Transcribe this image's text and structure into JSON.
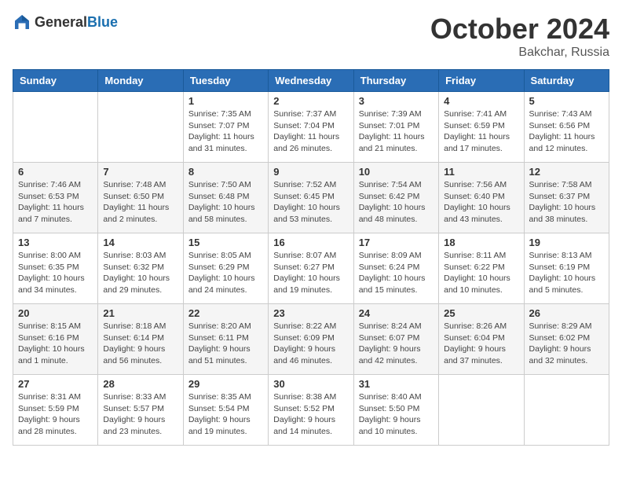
{
  "header": {
    "logo_general": "General",
    "logo_blue": "Blue",
    "month": "October 2024",
    "location": "Bakchar, Russia"
  },
  "weekdays": [
    "Sunday",
    "Monday",
    "Tuesday",
    "Wednesday",
    "Thursday",
    "Friday",
    "Saturday"
  ],
  "weeks": [
    [
      {
        "day": "",
        "info": ""
      },
      {
        "day": "",
        "info": ""
      },
      {
        "day": "1",
        "info": "Sunrise: 7:35 AM\nSunset: 7:07 PM\nDaylight: 11 hours and 31 minutes."
      },
      {
        "day": "2",
        "info": "Sunrise: 7:37 AM\nSunset: 7:04 PM\nDaylight: 11 hours and 26 minutes."
      },
      {
        "day": "3",
        "info": "Sunrise: 7:39 AM\nSunset: 7:01 PM\nDaylight: 11 hours and 21 minutes."
      },
      {
        "day": "4",
        "info": "Sunrise: 7:41 AM\nSunset: 6:59 PM\nDaylight: 11 hours and 17 minutes."
      },
      {
        "day": "5",
        "info": "Sunrise: 7:43 AM\nSunset: 6:56 PM\nDaylight: 11 hours and 12 minutes."
      }
    ],
    [
      {
        "day": "6",
        "info": "Sunrise: 7:46 AM\nSunset: 6:53 PM\nDaylight: 11 hours and 7 minutes."
      },
      {
        "day": "7",
        "info": "Sunrise: 7:48 AM\nSunset: 6:50 PM\nDaylight: 11 hours and 2 minutes."
      },
      {
        "day": "8",
        "info": "Sunrise: 7:50 AM\nSunset: 6:48 PM\nDaylight: 10 hours and 58 minutes."
      },
      {
        "day": "9",
        "info": "Sunrise: 7:52 AM\nSunset: 6:45 PM\nDaylight: 10 hours and 53 minutes."
      },
      {
        "day": "10",
        "info": "Sunrise: 7:54 AM\nSunset: 6:42 PM\nDaylight: 10 hours and 48 minutes."
      },
      {
        "day": "11",
        "info": "Sunrise: 7:56 AM\nSunset: 6:40 PM\nDaylight: 10 hours and 43 minutes."
      },
      {
        "day": "12",
        "info": "Sunrise: 7:58 AM\nSunset: 6:37 PM\nDaylight: 10 hours and 38 minutes."
      }
    ],
    [
      {
        "day": "13",
        "info": "Sunrise: 8:00 AM\nSunset: 6:35 PM\nDaylight: 10 hours and 34 minutes."
      },
      {
        "day": "14",
        "info": "Sunrise: 8:03 AM\nSunset: 6:32 PM\nDaylight: 10 hours and 29 minutes."
      },
      {
        "day": "15",
        "info": "Sunrise: 8:05 AM\nSunset: 6:29 PM\nDaylight: 10 hours and 24 minutes."
      },
      {
        "day": "16",
        "info": "Sunrise: 8:07 AM\nSunset: 6:27 PM\nDaylight: 10 hours and 19 minutes."
      },
      {
        "day": "17",
        "info": "Sunrise: 8:09 AM\nSunset: 6:24 PM\nDaylight: 10 hours and 15 minutes."
      },
      {
        "day": "18",
        "info": "Sunrise: 8:11 AM\nSunset: 6:22 PM\nDaylight: 10 hours and 10 minutes."
      },
      {
        "day": "19",
        "info": "Sunrise: 8:13 AM\nSunset: 6:19 PM\nDaylight: 10 hours and 5 minutes."
      }
    ],
    [
      {
        "day": "20",
        "info": "Sunrise: 8:15 AM\nSunset: 6:16 PM\nDaylight: 10 hours and 1 minute."
      },
      {
        "day": "21",
        "info": "Sunrise: 8:18 AM\nSunset: 6:14 PM\nDaylight: 9 hours and 56 minutes."
      },
      {
        "day": "22",
        "info": "Sunrise: 8:20 AM\nSunset: 6:11 PM\nDaylight: 9 hours and 51 minutes."
      },
      {
        "day": "23",
        "info": "Sunrise: 8:22 AM\nSunset: 6:09 PM\nDaylight: 9 hours and 46 minutes."
      },
      {
        "day": "24",
        "info": "Sunrise: 8:24 AM\nSunset: 6:07 PM\nDaylight: 9 hours and 42 minutes."
      },
      {
        "day": "25",
        "info": "Sunrise: 8:26 AM\nSunset: 6:04 PM\nDaylight: 9 hours and 37 minutes."
      },
      {
        "day": "26",
        "info": "Sunrise: 8:29 AM\nSunset: 6:02 PM\nDaylight: 9 hours and 32 minutes."
      }
    ],
    [
      {
        "day": "27",
        "info": "Sunrise: 8:31 AM\nSunset: 5:59 PM\nDaylight: 9 hours and 28 minutes."
      },
      {
        "day": "28",
        "info": "Sunrise: 8:33 AM\nSunset: 5:57 PM\nDaylight: 9 hours and 23 minutes."
      },
      {
        "day": "29",
        "info": "Sunrise: 8:35 AM\nSunset: 5:54 PM\nDaylight: 9 hours and 19 minutes."
      },
      {
        "day": "30",
        "info": "Sunrise: 8:38 AM\nSunset: 5:52 PM\nDaylight: 9 hours and 14 minutes."
      },
      {
        "day": "31",
        "info": "Sunrise: 8:40 AM\nSunset: 5:50 PM\nDaylight: 9 hours and 10 minutes."
      },
      {
        "day": "",
        "info": ""
      },
      {
        "day": "",
        "info": ""
      }
    ]
  ]
}
